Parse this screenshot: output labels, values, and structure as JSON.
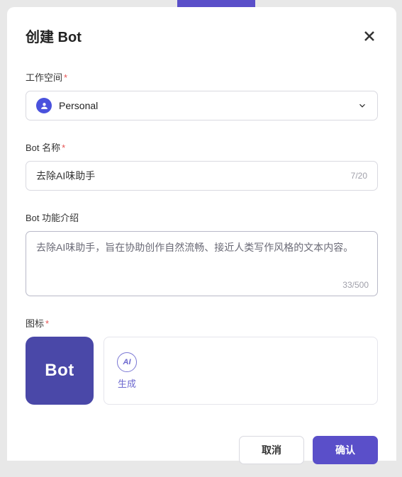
{
  "header": {
    "title": "创建 Bot"
  },
  "form": {
    "workspace": {
      "label": "工作空间",
      "value": "Personal"
    },
    "name": {
      "label": "Bot 名称",
      "value": "去除AI味助手",
      "counter": "7/20"
    },
    "desc": {
      "label": "Bot 功能介绍",
      "value": "去除AI味助手，旨在协助创作自然流畅、接近人类写作风格的文本内容。",
      "counter": "33/500"
    },
    "icon": {
      "label": "图标",
      "preview_text": "Bot",
      "generate_label": "生成",
      "generate_symbol": "AI"
    }
  },
  "footer": {
    "cancel": "取消",
    "confirm": "确认"
  },
  "required_mark": "*"
}
